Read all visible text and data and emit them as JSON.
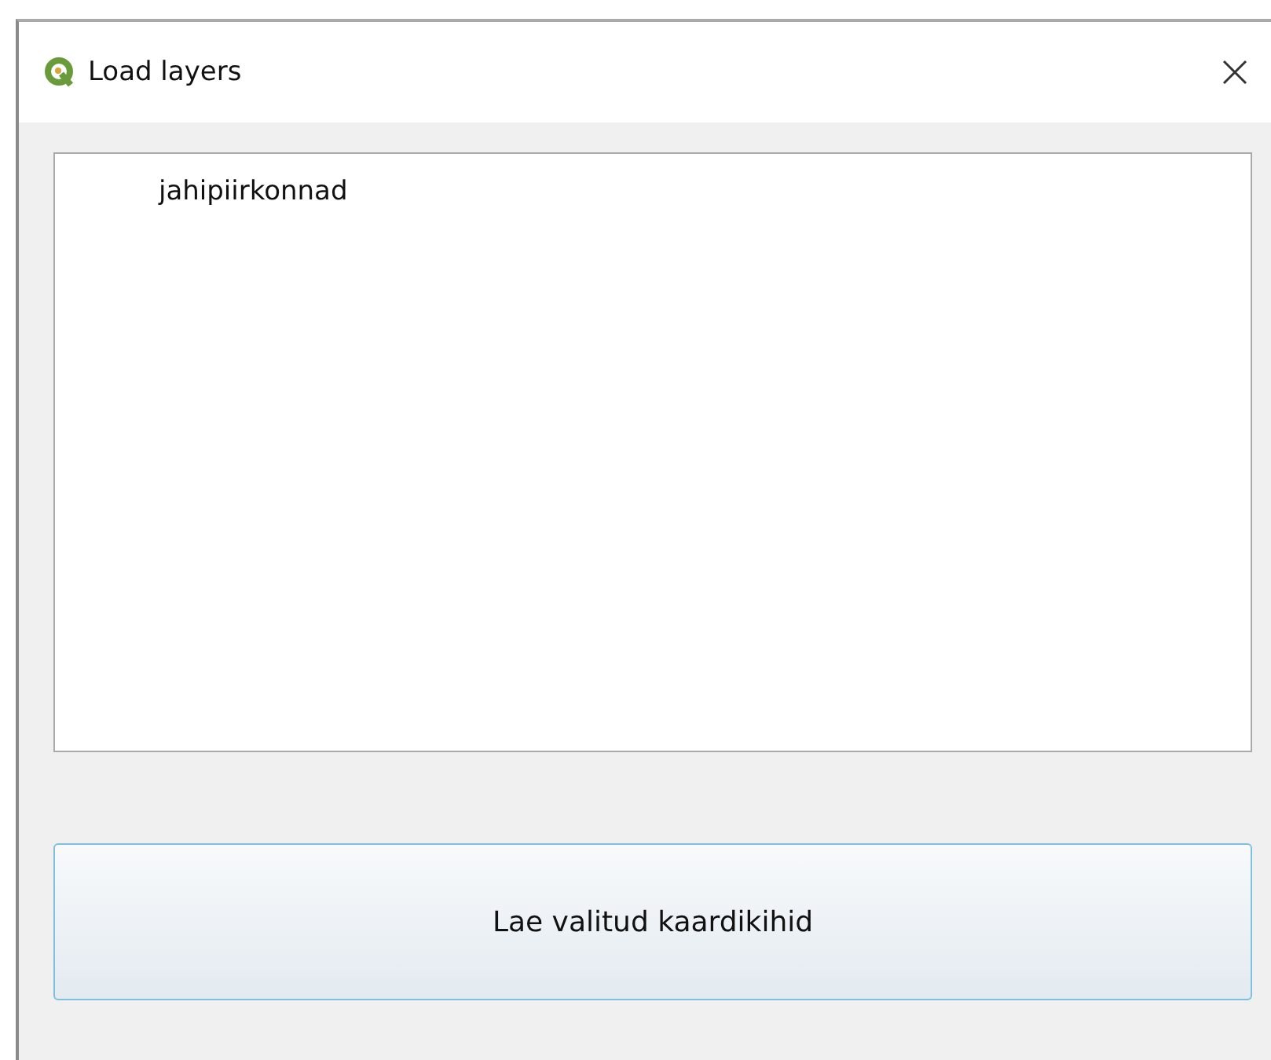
{
  "window": {
    "title": "Load layers"
  },
  "layers": [
    {
      "label": "jahipiirkonnad"
    }
  ],
  "buttons": [
    "Lae valitud kaardikihid"
  ]
}
